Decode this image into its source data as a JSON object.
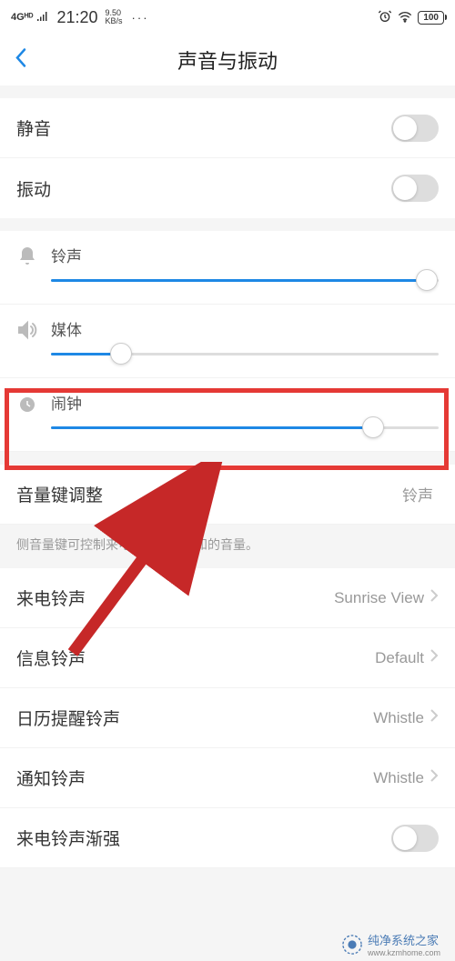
{
  "status": {
    "network": "4Gᴴᴰ",
    "time": "21:20",
    "speed": "9.50",
    "speed_unit": "KB/s",
    "dots": "···",
    "battery": "100"
  },
  "header": {
    "title": "声音与振动"
  },
  "toggles": {
    "mute": "静音",
    "vibrate": "振动"
  },
  "sliders": {
    "ring": "铃声",
    "media": "媒体",
    "alarm": "闹钟",
    "ring_pct": 97,
    "media_pct": 18,
    "alarm_pct": 83
  },
  "volumeKey": {
    "label": "音量键调整",
    "value": "铃声",
    "hint": "侧音量键可控制来电、信息和通知的音量。"
  },
  "ringtones": {
    "incoming": {
      "label": "来电铃声",
      "value": "Sunrise View"
    },
    "message": {
      "label": "信息铃声",
      "value": "Default"
    },
    "calendar": {
      "label": "日历提醒铃声",
      "value": "Whistle"
    },
    "notify": {
      "label": "通知铃声",
      "value": "Whistle"
    },
    "crescendo": {
      "label": "来电铃声渐强"
    }
  },
  "watermark": {
    "brand": "纯净系统之家",
    "url": "www.kzmhome.com"
  }
}
